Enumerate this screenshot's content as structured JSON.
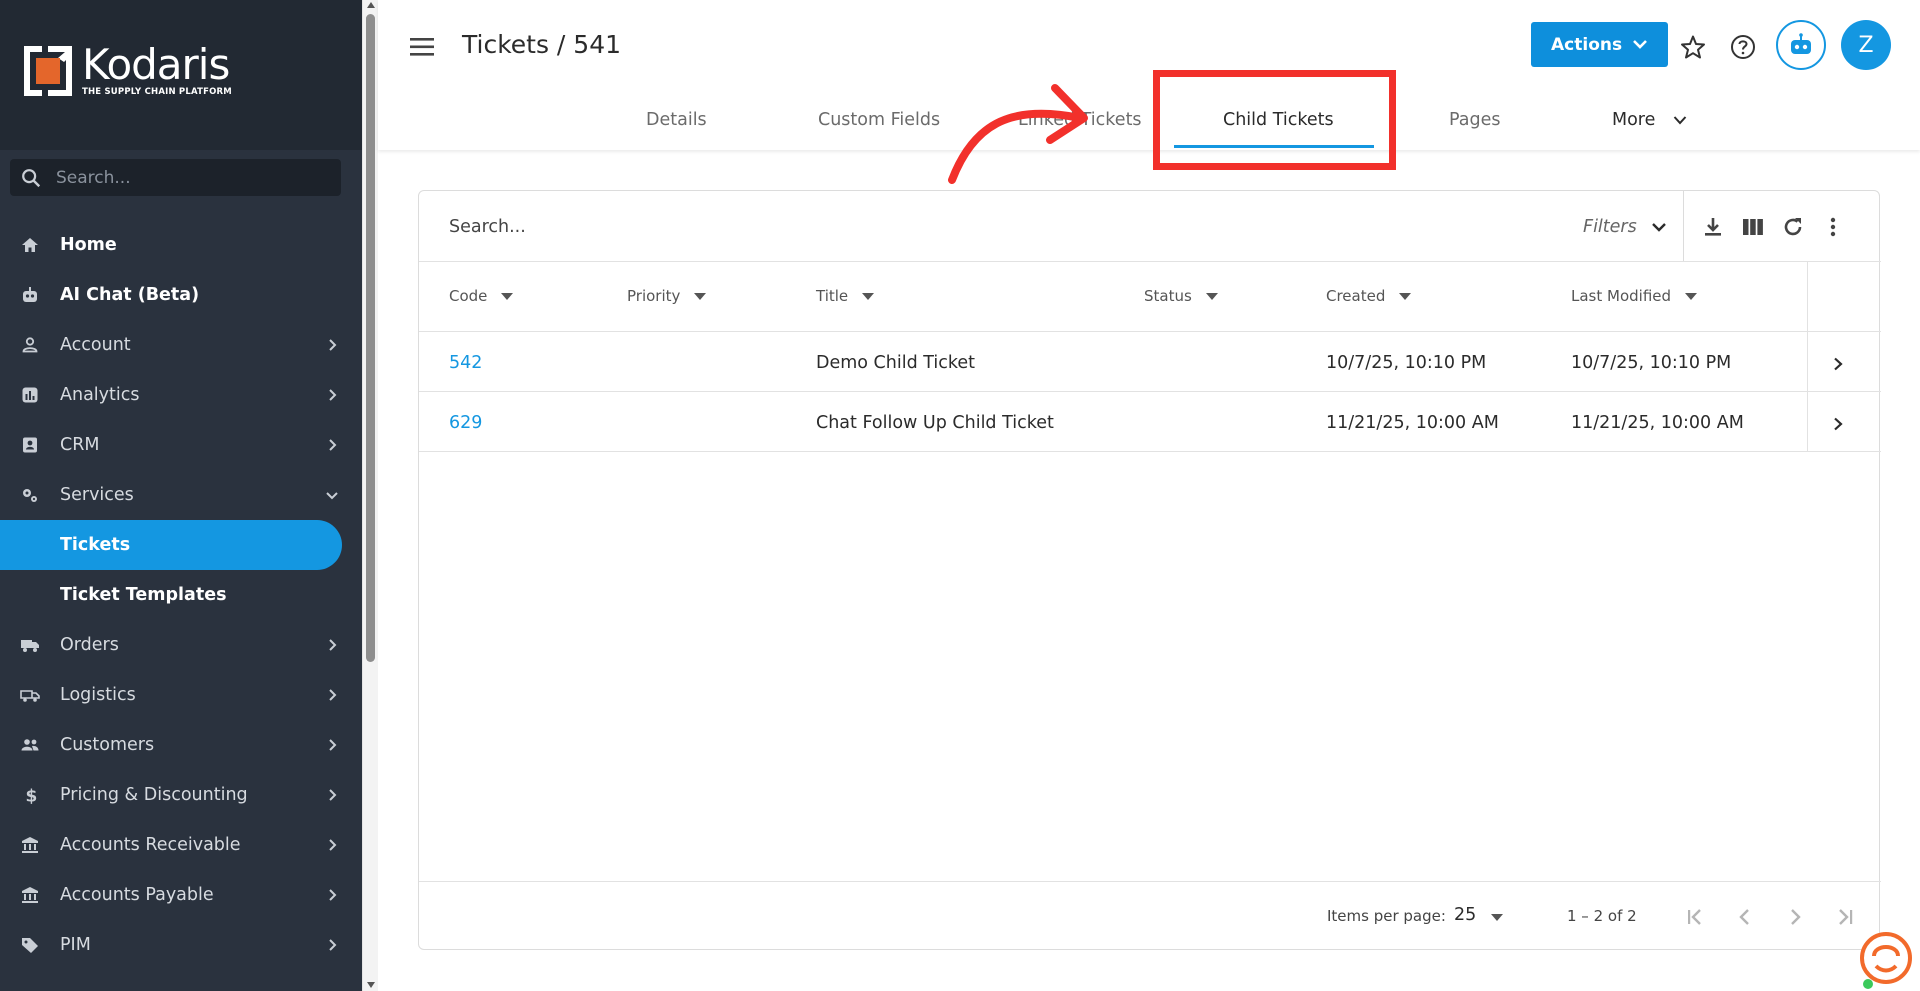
{
  "app": {
    "logo_word": "Kodaris",
    "logo_tagline": "THE SUPPLY CHAIN PLATFORM",
    "brand_color": "#1497e1",
    "sidebar_bg": "#2a323e"
  },
  "sidebar": {
    "search_placeholder": "Search...",
    "items": [
      {
        "label": "Home",
        "icon": "home-icon",
        "chevron": false
      },
      {
        "label": "AI Chat (Beta)",
        "icon": "robot-icon",
        "chevron": false
      },
      {
        "label": "Account",
        "icon": "person-icon",
        "chevron": true
      },
      {
        "label": "Analytics",
        "icon": "analytics-icon",
        "chevron": true
      },
      {
        "label": "CRM",
        "icon": "contacts-icon",
        "chevron": true
      },
      {
        "label": "Services",
        "icon": "gears-icon",
        "chevron": true,
        "expanded": true
      },
      {
        "label": "Tickets",
        "active": true
      },
      {
        "label": "Ticket Templates"
      },
      {
        "label": "Orders",
        "icon": "truck-icon",
        "chevron": true
      },
      {
        "label": "Logistics",
        "icon": "delivery-icon",
        "chevron": true
      },
      {
        "label": "Customers",
        "icon": "people-icon",
        "chevron": true
      },
      {
        "label": "Pricing & Discounting",
        "icon": "dollar-icon",
        "chevron": true
      },
      {
        "label": "Accounts Receivable",
        "icon": "bank-icon",
        "chevron": true
      },
      {
        "label": "Accounts Payable",
        "icon": "bank-icon",
        "chevron": true
      },
      {
        "label": "PIM",
        "icon": "tag-icon",
        "chevron": true
      }
    ]
  },
  "header": {
    "title": "Tickets / 541",
    "actions_label": "Actions",
    "avatar_initial": "Z"
  },
  "tabs": [
    {
      "label": "Details"
    },
    {
      "label": "Custom Fields"
    },
    {
      "label": "Linked Tickets"
    },
    {
      "label": "Child Tickets",
      "active": true
    },
    {
      "label": "Pages"
    },
    {
      "label": "More"
    }
  ],
  "table": {
    "search_placeholder": "Search...",
    "filters_label": "Filters",
    "columns": [
      "Code",
      "Priority",
      "Title",
      "Status",
      "Created",
      "Last Modified"
    ],
    "rows": [
      {
        "code": "542",
        "priority": "",
        "title": "Demo Child Ticket",
        "status": "",
        "created": "10/7/25, 10:10 PM",
        "modified": "10/7/25, 10:10 PM"
      },
      {
        "code": "629",
        "priority": "",
        "title": "Chat Follow Up Child Ticket",
        "status": "",
        "created": "11/21/25, 10:00 AM",
        "modified": "11/21/25, 10:00 AM"
      }
    ],
    "items_per_page_label": "Items per page:",
    "items_per_page": "25",
    "range": "1 – 2 of 2"
  },
  "annotation_color": "#f2302b"
}
